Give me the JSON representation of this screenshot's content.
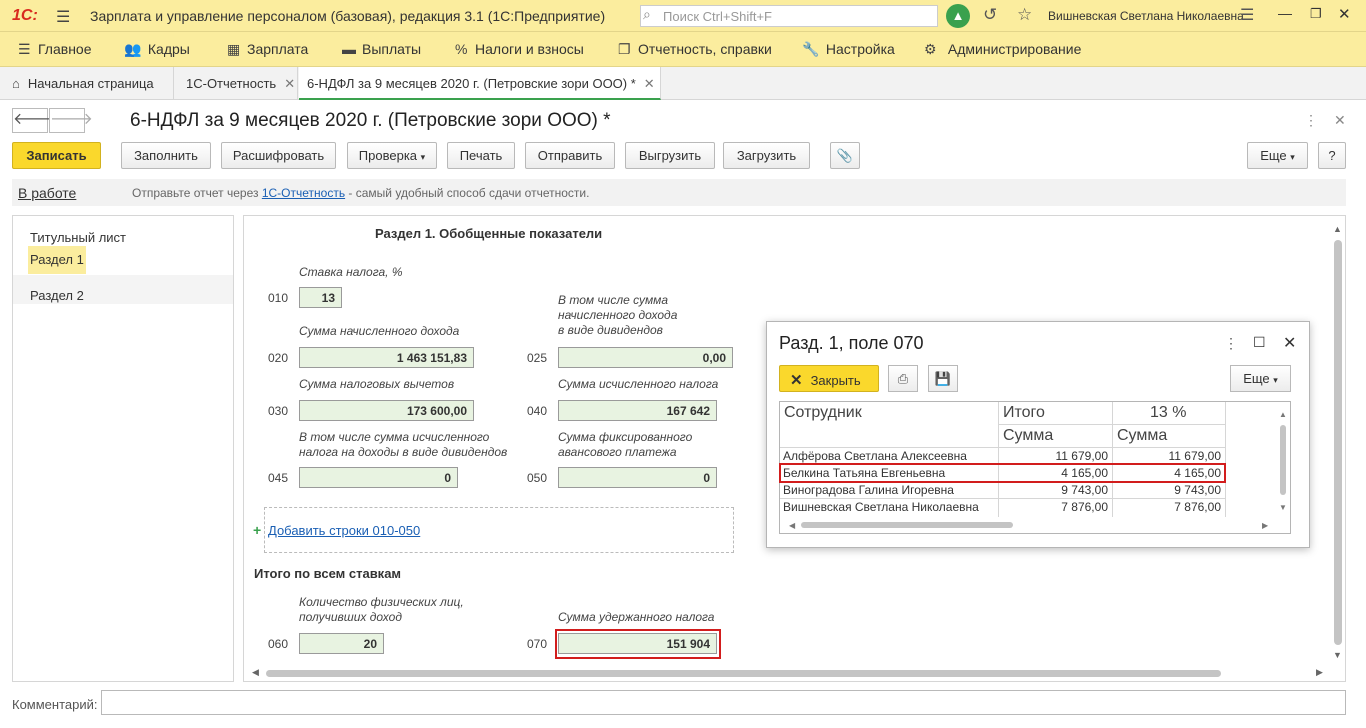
{
  "app": {
    "logo": "1С:",
    "title": "Зарплата и управление персоналом (базовая), редакция 3.1  (1С:Предприятие)",
    "search_placeholder": "Поиск Ctrl+Shift+F",
    "user": "Вишневская Светлана Николаевна"
  },
  "sections": [
    {
      "label": "Главное",
      "icon": "menu-icon"
    },
    {
      "label": "Кадры",
      "icon": "people-icon"
    },
    {
      "label": "Зарплата",
      "icon": "calculator-icon"
    },
    {
      "label": "Выплаты",
      "icon": "wallet-icon"
    },
    {
      "label": "Налоги и взносы",
      "icon": "percent-icon"
    },
    {
      "label": "Отчетность, справки",
      "icon": "reports-icon"
    },
    {
      "label": "Настройка",
      "icon": "wrench-icon"
    },
    {
      "label": "Администрирование",
      "icon": "gear-icon"
    }
  ],
  "tabs": [
    {
      "label": "Начальная страница"
    },
    {
      "label": "1С-Отчетность"
    },
    {
      "label": "6-НДФЛ за 9 месяцев 2020 г. (Петровские зори ООО) *"
    }
  ],
  "doc": {
    "title": "6-НДФЛ за 9 месяцев 2020 г. (Петровские зори ООО) *"
  },
  "toolbar": {
    "save": "Записать",
    "fill": "Заполнить",
    "decode": "Расшифровать",
    "check": "Проверка",
    "print": "Печать",
    "send": "Отправить",
    "export": "Выгрузить",
    "import": "Загрузить",
    "more": "Еще",
    "help": "?"
  },
  "info": {
    "status": "В работе",
    "text_before": "Отправьте отчет через ",
    "link": "1С-Отчетность",
    "text_after": " - самый удобный способ сдачи отчетности."
  },
  "nav": [
    "Титульный лист",
    "Раздел 1",
    "Раздел 2"
  ],
  "form": {
    "section_title": "Раздел 1. Обобщенные показатели",
    "tax_rate_label": "Ставка налога, %",
    "f010_code": "010",
    "f010": "13",
    "f020_label": "Сумма начисленного дохода",
    "f020_code": "020",
    "f020": "1 463 151,83",
    "f025_label": "В том числе сумма начисленного дохода в виде дивидендов",
    "f025_l1": "В том числе сумма",
    "f025_l2": "начисленного дохода",
    "f025_l3": "в виде дивидендов",
    "f025_code": "025",
    "f025": "0,00",
    "f030_label": "Сумма налоговых вычетов",
    "f030_code": "030",
    "f030": "173 600,00",
    "f040_label": "Сумма исчисленного налога",
    "f040_code": "040",
    "f040": "167 642",
    "f045_l1": "В том числе сумма исчисленного",
    "f045_l2": "налога на доходы в виде дивидендов",
    "f045_code": "045",
    "f045": "0",
    "f050_l1": "Сумма фиксированного",
    "f050_l2": "авансового платежа",
    "f050_code": "050",
    "f050": "0",
    "add_rows": "Добавить строки 010-050",
    "total_title": "Итого по всем ставкам",
    "f060_l1": "Количество физических лиц,",
    "f060_l2": "получивших доход",
    "f060_code": "060",
    "f060": "20",
    "f070_label": "Сумма удержанного налога",
    "f070_code": "070",
    "f070": "151 904"
  },
  "popup": {
    "title": "Разд. 1, поле 070",
    "close_btn": "Закрыть",
    "more": "Еще",
    "columns": {
      "employee": "Сотрудник",
      "total": "Итого",
      "rate": "13 %",
      "sum1": "Сумма",
      "sum2": "Сумма"
    },
    "rows": [
      {
        "name": "Алфёрова Светлана Алексеевна",
        "total": "11 679,00",
        "rate": "11 679,00"
      },
      {
        "name": "Белкина Татьяна Евгеньевна",
        "total": "4 165,00",
        "rate": "4 165,00"
      },
      {
        "name": "Виноградова Галина Игоревна",
        "total": "9 743,00",
        "rate": "9 743,00"
      },
      {
        "name": "Вишневская Светлана Николаевна",
        "total": "7 876,00",
        "rate": "7 876,00"
      }
    ]
  },
  "comment_label": "Комментарий:",
  "colors": {
    "accent_yellow": "#fad82c",
    "green": "#3aa14e",
    "highlight_red": "#d21d1d",
    "field_bg": "#e8f3e1"
  }
}
